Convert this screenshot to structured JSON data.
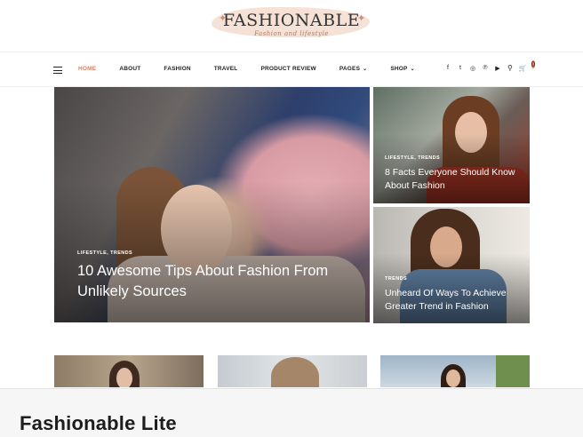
{
  "site": {
    "logo_title": "FASHIONABLE",
    "logo_tagline": "Fashion and lifestyle",
    "logo_sparkle": "✦"
  },
  "nav": {
    "menu_items": [
      {
        "label": "HOME",
        "active": true
      },
      {
        "label": "ABOUT"
      },
      {
        "label": "FASHION"
      },
      {
        "label": "TRAVEL"
      },
      {
        "label": "PRODUCT REVIEW"
      },
      {
        "label": "PAGES",
        "dropdown": true
      },
      {
        "label": "SHOP",
        "dropdown": true
      }
    ],
    "dropdown_glyph": "⌄",
    "social_icons": [
      {
        "name": "facebook-icon",
        "glyph": "f"
      },
      {
        "name": "twitter-icon",
        "glyph": "t"
      },
      {
        "name": "instagram-icon",
        "glyph": "◎"
      },
      {
        "name": "pinterest-icon",
        "glyph": "℗"
      },
      {
        "name": "youtube-icon",
        "glyph": "▶"
      }
    ],
    "search_glyph": "⚲",
    "cart_glyph": "🛒",
    "cart_count": "0",
    "accent_color": "#d77f60"
  },
  "featured": {
    "main": {
      "categories": "LIFESTYLE, TRENDS",
      "title": "10 Awesome Tips About Fashion From Unlikely Sources"
    },
    "side_top": {
      "categories": "LIFESTYLE, TRENDS",
      "title": "8 Facts Everyone Should Know About Fashion"
    },
    "side_bottom": {
      "categories": "TRENDS",
      "title": "Unheard Of Ways To Achieve Greater Trend in Fashion"
    }
  },
  "bottom_panel": {
    "title": "Fashionable Lite"
  }
}
